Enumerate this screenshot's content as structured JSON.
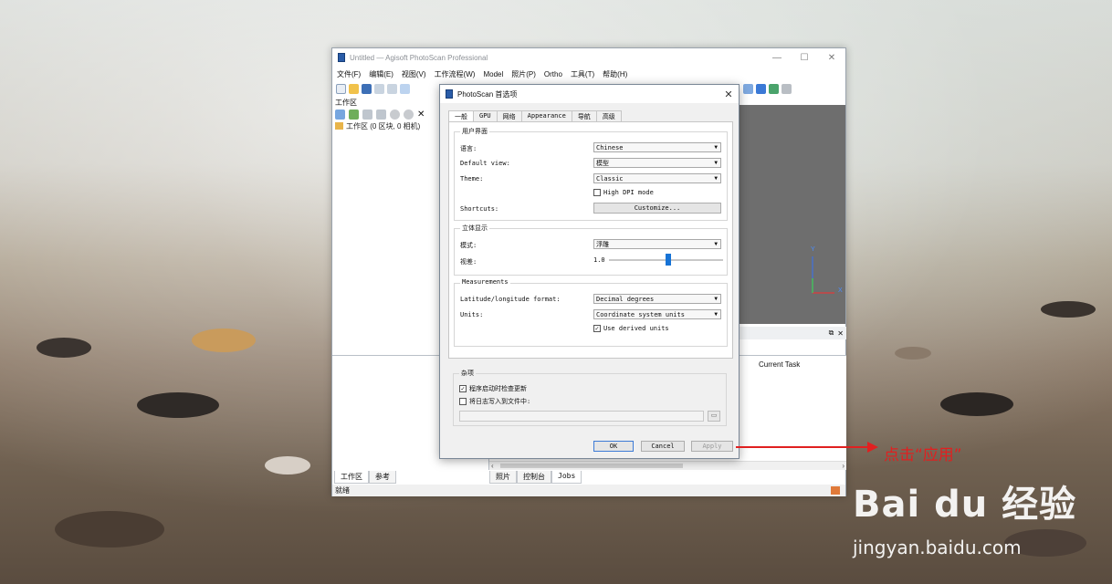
{
  "window": {
    "title": "Untitled — Agisoft PhotoScan Professional",
    "controls": {
      "minimize": "—",
      "maximize": "☐",
      "close": "✕"
    }
  },
  "menu": [
    "文件(F)",
    "编辑(E)",
    "视图(V)",
    "工作流程(W)",
    "Model",
    "照片(P)",
    "Ortho",
    "工具(T)",
    "帮助(H)"
  ],
  "workspace": {
    "panel_title": "工作区",
    "tree_root": "工作区 (0 区块, 0 相机)"
  },
  "jobs": {
    "column": "Current Task"
  },
  "bottom_tabs_left": [
    "工作区",
    "参考"
  ],
  "bottom_tabs_right": [
    "照片",
    "控制台",
    "Jobs"
  ],
  "status": "就绪",
  "viewport_axes": {
    "y": "Y",
    "x": "X"
  },
  "dialog": {
    "title": "PhotoScan 首选项",
    "close": "✕",
    "tabs": [
      "一般",
      "GPU",
      "网络",
      "Appearance",
      "导航",
      "高级"
    ],
    "ui_group": {
      "label": "用户界面",
      "language_label": "语言:",
      "language_value": "Chinese",
      "default_view_label": "Default view:",
      "default_view_value": "模型",
      "theme_label": "Theme:",
      "theme_value": "Classic",
      "high_dpi_label": "High DPI mode",
      "high_dpi_checked": false,
      "shortcuts_label": "Shortcuts:",
      "customize_button": "Customize..."
    },
    "stereo_group": {
      "label": "立体显示",
      "mode_label": "模式:",
      "mode_value": "浮雕",
      "parallax_label": "视差:",
      "parallax_value": "1.0",
      "parallax_slider_fraction": 0.5
    },
    "measurements_group": {
      "label": "Measurements",
      "latlon_label": "Latitude/longitude format:",
      "latlon_value": "Decimal degrees",
      "units_label": "Units:",
      "units_value": "Coordinate system units",
      "derived_units_label": "Use derived units",
      "derived_units_checked": true
    },
    "misc_group": {
      "label": "杂项",
      "check_updates_label": "程序启动时检查更新",
      "check_updates_checked": true,
      "log_to_file_label": "将日志写入到文件中:",
      "log_to_file_checked": false,
      "log_path": ""
    },
    "buttons": {
      "ok": "OK",
      "cancel": "Cancel",
      "apply": "Apply"
    }
  },
  "annotation": {
    "text": "点击“应用”",
    "color": "#e02020"
  },
  "watermark": {
    "logo": "Bai du 经验",
    "url": "jingyan.baidu.com"
  }
}
